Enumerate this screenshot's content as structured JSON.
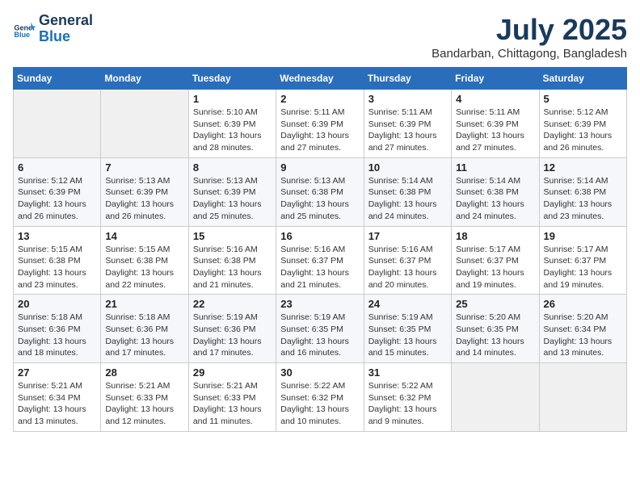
{
  "logo": {
    "line1": "General",
    "line2": "Blue"
  },
  "title": "July 2025",
  "subtitle": "Bandarban, Chittagong, Bangladesh",
  "weekdays": [
    "Sunday",
    "Monday",
    "Tuesday",
    "Wednesday",
    "Thursday",
    "Friday",
    "Saturday"
  ],
  "weeks": [
    [
      {
        "day": "",
        "info": ""
      },
      {
        "day": "",
        "info": ""
      },
      {
        "day": "1",
        "info": "Sunrise: 5:10 AM\nSunset: 6:39 PM\nDaylight: 13 hours\nand 28 minutes."
      },
      {
        "day": "2",
        "info": "Sunrise: 5:11 AM\nSunset: 6:39 PM\nDaylight: 13 hours\nand 27 minutes."
      },
      {
        "day": "3",
        "info": "Sunrise: 5:11 AM\nSunset: 6:39 PM\nDaylight: 13 hours\nand 27 minutes."
      },
      {
        "day": "4",
        "info": "Sunrise: 5:11 AM\nSunset: 6:39 PM\nDaylight: 13 hours\nand 27 minutes."
      },
      {
        "day": "5",
        "info": "Sunrise: 5:12 AM\nSunset: 6:39 PM\nDaylight: 13 hours\nand 26 minutes."
      }
    ],
    [
      {
        "day": "6",
        "info": "Sunrise: 5:12 AM\nSunset: 6:39 PM\nDaylight: 13 hours\nand 26 minutes."
      },
      {
        "day": "7",
        "info": "Sunrise: 5:13 AM\nSunset: 6:39 PM\nDaylight: 13 hours\nand 26 minutes."
      },
      {
        "day": "8",
        "info": "Sunrise: 5:13 AM\nSunset: 6:39 PM\nDaylight: 13 hours\nand 25 minutes."
      },
      {
        "day": "9",
        "info": "Sunrise: 5:13 AM\nSunset: 6:38 PM\nDaylight: 13 hours\nand 25 minutes."
      },
      {
        "day": "10",
        "info": "Sunrise: 5:14 AM\nSunset: 6:38 PM\nDaylight: 13 hours\nand 24 minutes."
      },
      {
        "day": "11",
        "info": "Sunrise: 5:14 AM\nSunset: 6:38 PM\nDaylight: 13 hours\nand 24 minutes."
      },
      {
        "day": "12",
        "info": "Sunrise: 5:14 AM\nSunset: 6:38 PM\nDaylight: 13 hours\nand 23 minutes."
      }
    ],
    [
      {
        "day": "13",
        "info": "Sunrise: 5:15 AM\nSunset: 6:38 PM\nDaylight: 13 hours\nand 23 minutes."
      },
      {
        "day": "14",
        "info": "Sunrise: 5:15 AM\nSunset: 6:38 PM\nDaylight: 13 hours\nand 22 minutes."
      },
      {
        "day": "15",
        "info": "Sunrise: 5:16 AM\nSunset: 6:38 PM\nDaylight: 13 hours\nand 21 minutes."
      },
      {
        "day": "16",
        "info": "Sunrise: 5:16 AM\nSunset: 6:37 PM\nDaylight: 13 hours\nand 21 minutes."
      },
      {
        "day": "17",
        "info": "Sunrise: 5:16 AM\nSunset: 6:37 PM\nDaylight: 13 hours\nand 20 minutes."
      },
      {
        "day": "18",
        "info": "Sunrise: 5:17 AM\nSunset: 6:37 PM\nDaylight: 13 hours\nand 19 minutes."
      },
      {
        "day": "19",
        "info": "Sunrise: 5:17 AM\nSunset: 6:37 PM\nDaylight: 13 hours\nand 19 minutes."
      }
    ],
    [
      {
        "day": "20",
        "info": "Sunrise: 5:18 AM\nSunset: 6:36 PM\nDaylight: 13 hours\nand 18 minutes."
      },
      {
        "day": "21",
        "info": "Sunrise: 5:18 AM\nSunset: 6:36 PM\nDaylight: 13 hours\nand 17 minutes."
      },
      {
        "day": "22",
        "info": "Sunrise: 5:19 AM\nSunset: 6:36 PM\nDaylight: 13 hours\nand 17 minutes."
      },
      {
        "day": "23",
        "info": "Sunrise: 5:19 AM\nSunset: 6:35 PM\nDaylight: 13 hours\nand 16 minutes."
      },
      {
        "day": "24",
        "info": "Sunrise: 5:19 AM\nSunset: 6:35 PM\nDaylight: 13 hours\nand 15 minutes."
      },
      {
        "day": "25",
        "info": "Sunrise: 5:20 AM\nSunset: 6:35 PM\nDaylight: 13 hours\nand 14 minutes."
      },
      {
        "day": "26",
        "info": "Sunrise: 5:20 AM\nSunset: 6:34 PM\nDaylight: 13 hours\nand 13 minutes."
      }
    ],
    [
      {
        "day": "27",
        "info": "Sunrise: 5:21 AM\nSunset: 6:34 PM\nDaylight: 13 hours\nand 13 minutes."
      },
      {
        "day": "28",
        "info": "Sunrise: 5:21 AM\nSunset: 6:33 PM\nDaylight: 13 hours\nand 12 minutes."
      },
      {
        "day": "29",
        "info": "Sunrise: 5:21 AM\nSunset: 6:33 PM\nDaylight: 13 hours\nand 11 minutes."
      },
      {
        "day": "30",
        "info": "Sunrise: 5:22 AM\nSunset: 6:32 PM\nDaylight: 13 hours\nand 10 minutes."
      },
      {
        "day": "31",
        "info": "Sunrise: 5:22 AM\nSunset: 6:32 PM\nDaylight: 13 hours\nand 9 minutes."
      },
      {
        "day": "",
        "info": ""
      },
      {
        "day": "",
        "info": ""
      }
    ]
  ]
}
